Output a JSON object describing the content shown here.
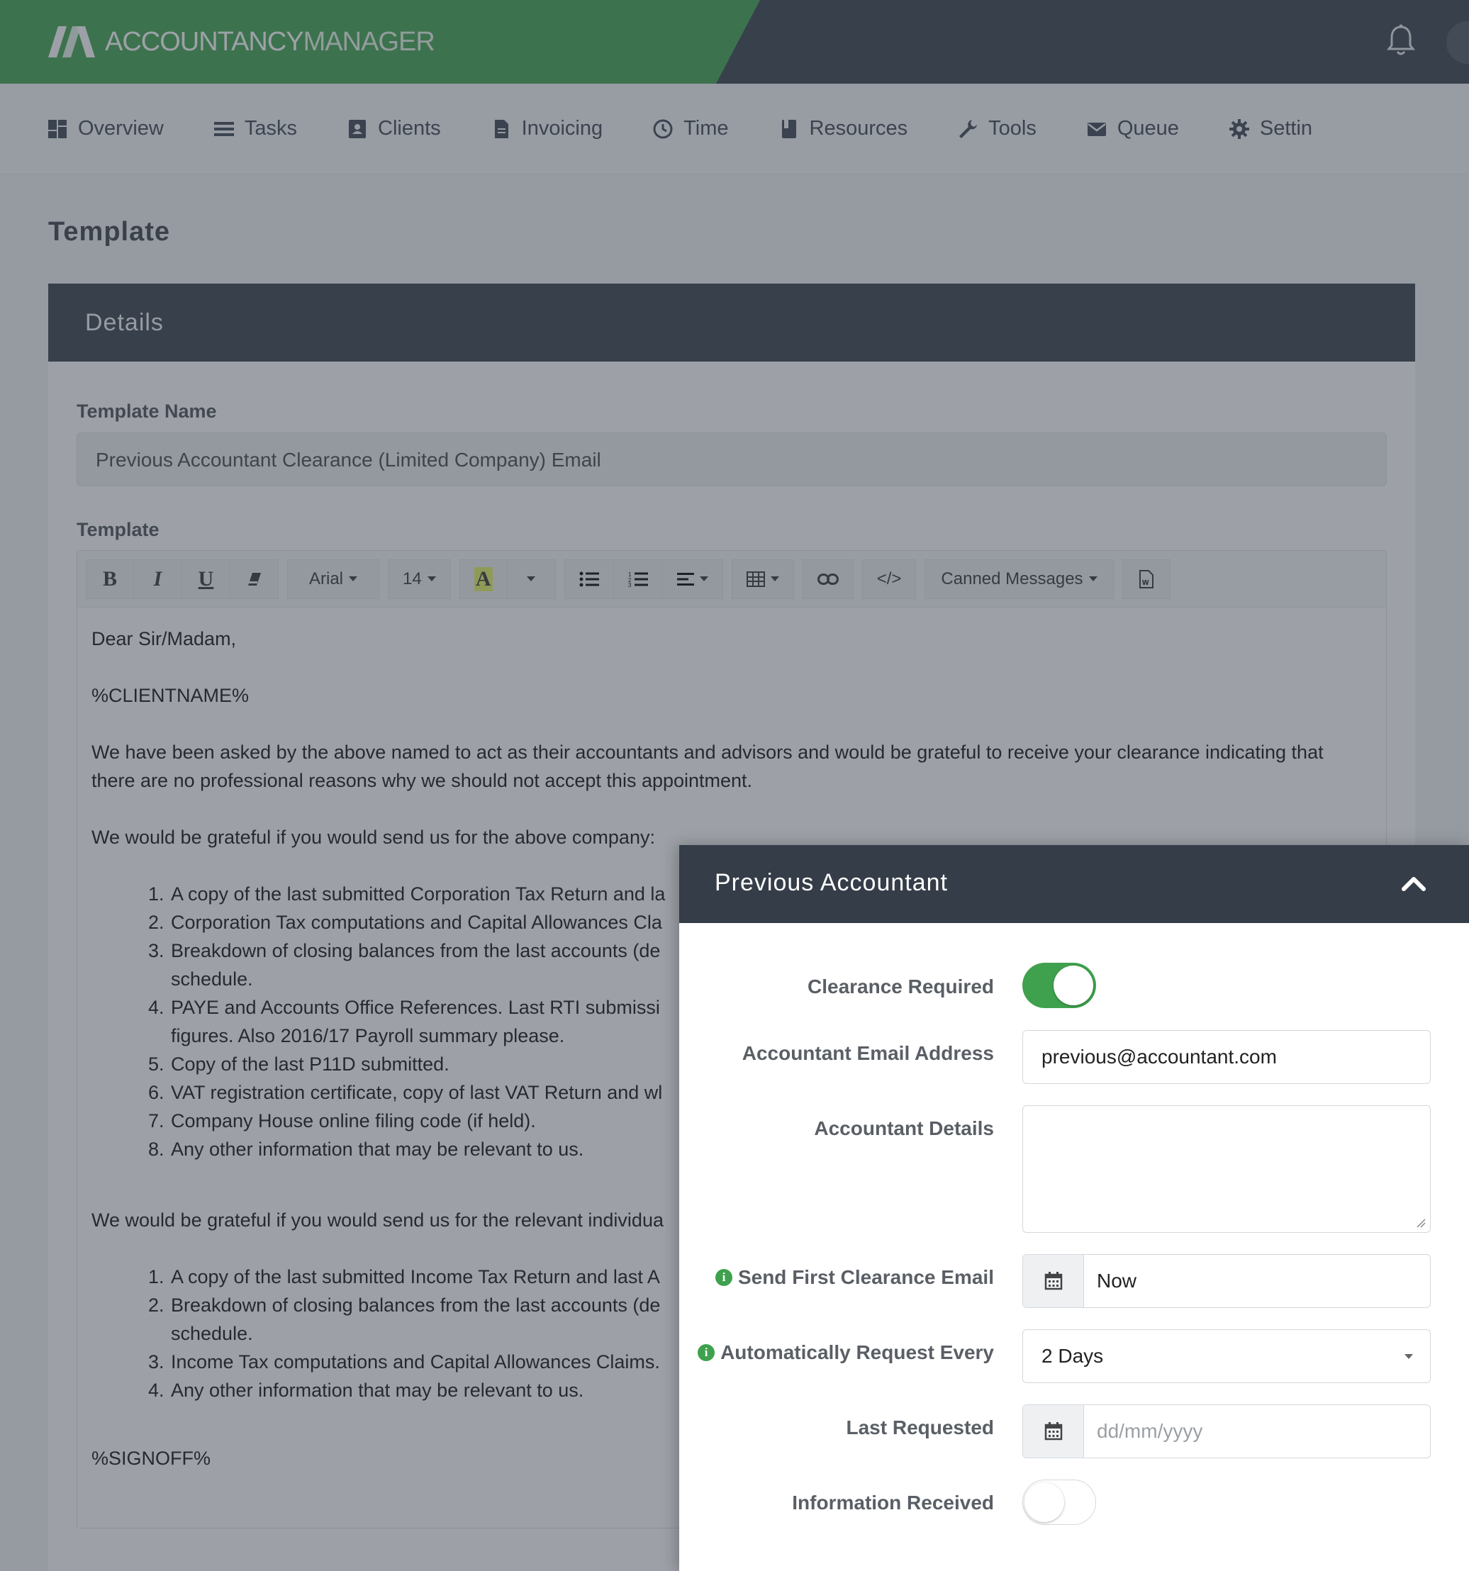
{
  "app": {
    "brand_bold": "ACCOUNTANCY",
    "brand_light": "MANAGER"
  },
  "nav": [
    {
      "label": "Overview",
      "icon": "dashboard-icon"
    },
    {
      "label": "Tasks",
      "icon": "list-icon"
    },
    {
      "label": "Clients",
      "icon": "contact-book-icon"
    },
    {
      "label": "Invoicing",
      "icon": "document-icon"
    },
    {
      "label": "Time",
      "icon": "clock-icon"
    },
    {
      "label": "Resources",
      "icon": "book-icon"
    },
    {
      "label": "Tools",
      "icon": "wrench-icon"
    },
    {
      "label": "Queue",
      "icon": "envelope-icon"
    },
    {
      "label": "Settin",
      "icon": "gear-icon"
    }
  ],
  "page": {
    "title": "Template"
  },
  "details": {
    "header": "Details",
    "template_name_label": "Template Name",
    "template_name_value": "Previous Accountant Clearance (Limited Company) Email",
    "template_label": "Template"
  },
  "toolbar": {
    "bold": "B",
    "italic": "I",
    "underline": "U",
    "font": "Arial",
    "size": "14",
    "color": "A",
    "code": "</>",
    "canned": "Canned Messages"
  },
  "editor": {
    "greeting": "Dear Sir/Madam,",
    "client_tag": "%CLIENTNAME%",
    "para1": "We have been asked by the above named to act as their accountants and advisors and would be grateful to receive your clearance indicating that there are no professional reasons why we should not accept this appointment.",
    "para2": "We would be grateful if you would send us for the above company:",
    "list1": [
      "A copy of the last submitted Corporation Tax Return and la",
      "Corporation Tax computations and Capital Allowances Cla",
      "Breakdown of closing balances from the last accounts (de",
      "schedule.",
      "PAYE and Accounts Office References. Last RTI submissi",
      "figures. Also 2016/17 Payroll summary please.",
      "Copy of the last P11D submitted.",
      "VAT registration certificate, copy of last VAT Return and wl",
      "Company House online filing code (if held).",
      "Any other information that may be relevant to us."
    ],
    "para3": "We would be grateful if you would send us for the relevant individua",
    "list2": [
      "A copy of the last submitted Income Tax Return and last A",
      "Breakdown of closing balances from the last accounts (de",
      "schedule.",
      "Income Tax computations and Capital Allowances Claims.",
      "Any other information that may be relevant to us."
    ],
    "signoff": "%SIGNOFF%"
  },
  "panel": {
    "title": "Previous Accountant",
    "clearance_required_label": "Clearance Required",
    "clearance_required": true,
    "email_label": "Accountant Email Address",
    "email_value": "previous@accountant.com",
    "details_label": "Accountant Details",
    "details_value": "",
    "first_email_label": "Send First Clearance Email",
    "first_email_value": "Now",
    "auto_request_label": "Automatically Request Every",
    "auto_request_value": "2 Days",
    "last_requested_label": "Last Requested",
    "last_requested_placeholder": "dd/mm/yyyy",
    "info_received_label": "Information Received",
    "info_received": false
  },
  "colors": {
    "brand_green": "#3fa14d",
    "dark": "#353d48"
  }
}
